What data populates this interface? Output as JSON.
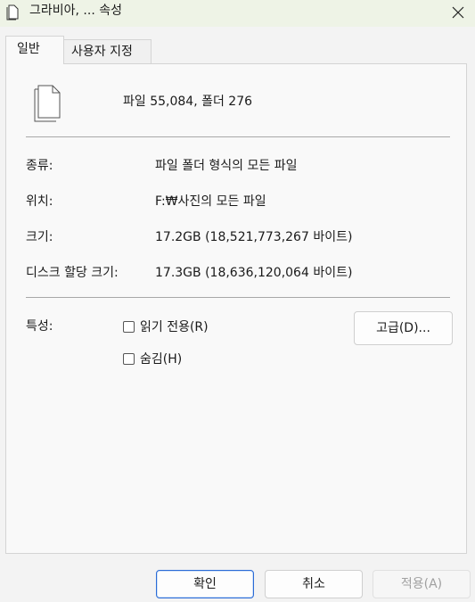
{
  "window": {
    "title": "그라비아, ... 속성",
    "close_icon": "close-icon"
  },
  "tabs": [
    {
      "label": "일반",
      "active": true
    },
    {
      "label": "사용자 지정",
      "active": false
    }
  ],
  "general": {
    "summary": "파일 55,084, 폴더 276",
    "rows": [
      {
        "label": "종류:",
        "value": "파일 폴더 형식의 모든 파일"
      },
      {
        "label": "위치:",
        "value": "F:₩사진의 모든 파일"
      },
      {
        "label": "크기:",
        "value": "17.2GB (18,521,773,267 바이트)"
      },
      {
        "label": "디스크 할당 크기:",
        "value": "17.3GB (18,636,120,064 바이트)"
      }
    ],
    "attributes_label": "특성:",
    "readonly_label": "읽기 전용(R)",
    "hidden_label": "숨김(H)",
    "advanced_button": "고급(D)..."
  },
  "footer": {
    "ok": "확인",
    "cancel": "취소",
    "apply": "적용(A)"
  }
}
